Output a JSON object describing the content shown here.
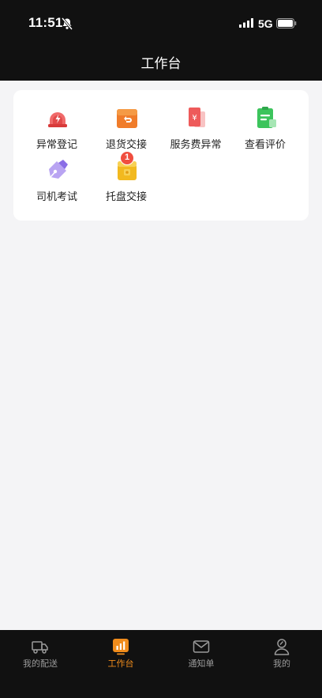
{
  "status_bar": {
    "time": "11:51",
    "network": "5G"
  },
  "header": {
    "title": "工作台"
  },
  "grid": {
    "items": [
      {
        "label": "异常登记",
        "icon": "alarm-light-icon"
      },
      {
        "label": "退货交接",
        "icon": "return-box-icon"
      },
      {
        "label": "服务费异常",
        "icon": "fee-document-icon"
      },
      {
        "label": "查看评价",
        "icon": "clipboard-review-icon"
      },
      {
        "label": "司机考试",
        "icon": "pen-exam-icon"
      },
      {
        "label": "托盘交接",
        "icon": "pallet-box-icon",
        "badge": "1"
      }
    ]
  },
  "tabbar": {
    "items": [
      {
        "label": "我的配送",
        "icon": "truck-icon"
      },
      {
        "label": "工作台",
        "icon": "workbench-chart-icon",
        "active": true
      },
      {
        "label": "通知单",
        "icon": "mail-icon"
      },
      {
        "label": "我的",
        "icon": "user-icon"
      }
    ]
  },
  "colors": {
    "accent": "#f08c1c",
    "dark": "#111111",
    "badge": "#f04e3f"
  }
}
